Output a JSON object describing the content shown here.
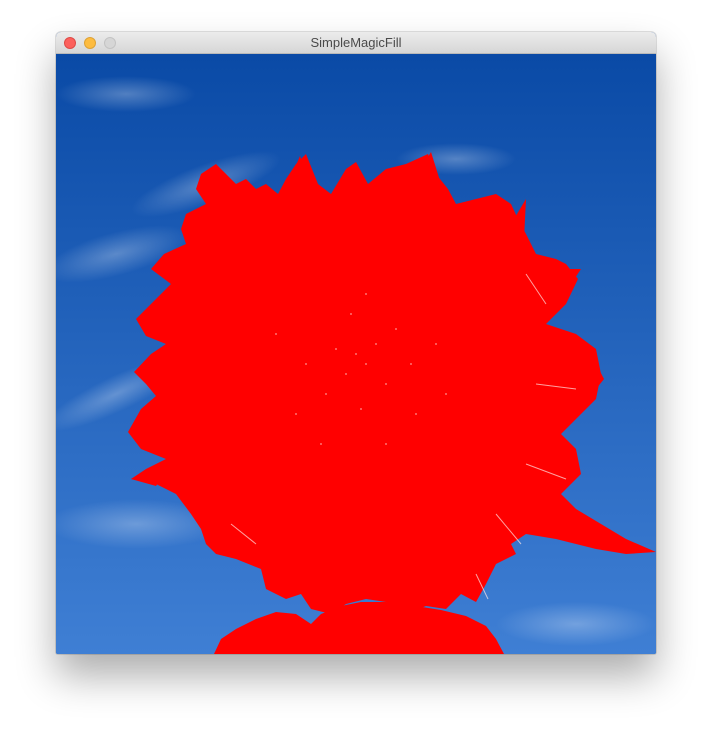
{
  "window": {
    "title": "SimpleMagicFill",
    "buttons": {
      "close_icon": "close-icon",
      "minimize_icon": "minimize-icon",
      "zoom_icon": "zoom-icon"
    }
  },
  "canvas": {
    "description_colors": {
      "sky_top": "#0a4aa6",
      "sky_bottom": "#3f7fd4",
      "fill": "#ff0000"
    }
  }
}
